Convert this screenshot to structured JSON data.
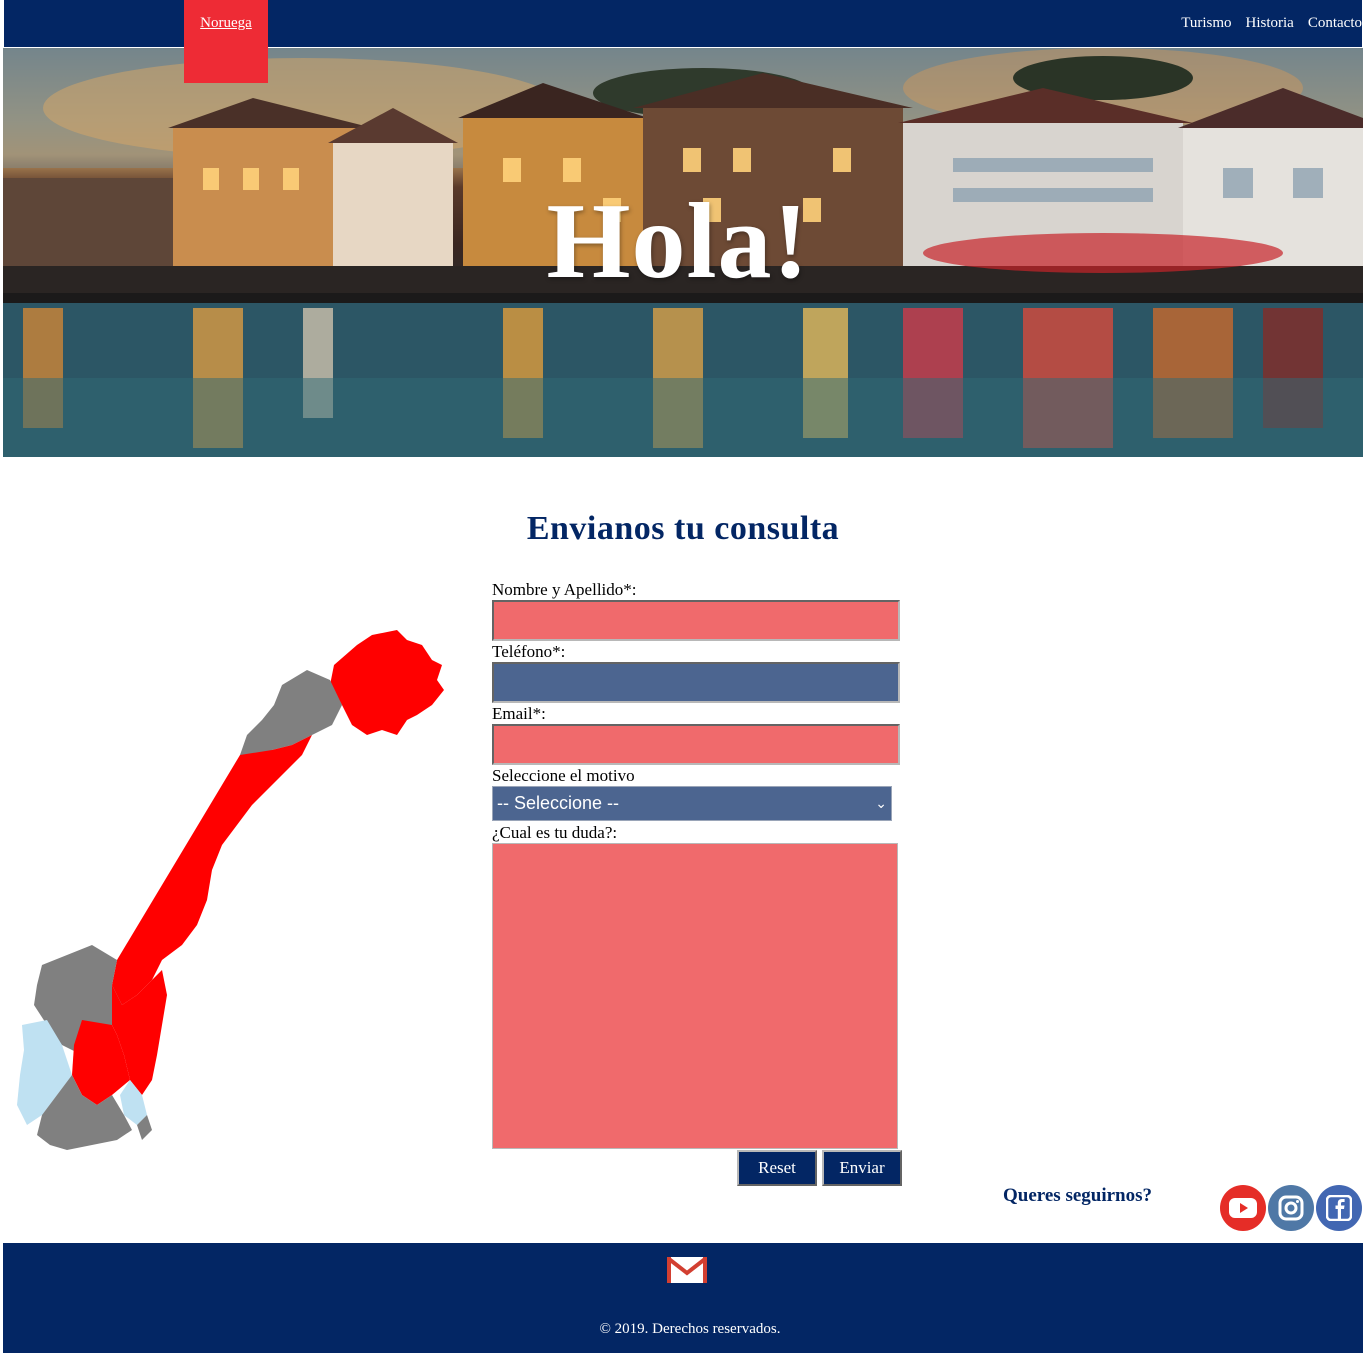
{
  "nav": {
    "brand": "Noruega",
    "links": [
      "Turismo",
      "Historia",
      "Contacto"
    ]
  },
  "hero": {
    "title": "Hola!"
  },
  "contact": {
    "title": "Envianos tu consulta",
    "name_label": "Nombre y Apellido*:",
    "phone_label": "Teléfono*:",
    "email_label": "Email*:",
    "reason_label": "Seleccione el motivo",
    "reason_selected": "-- Seleccione --",
    "question_label": "¿Cual es tu duda?:",
    "reset_label": "Reset",
    "send_label": "Enviar"
  },
  "social": {
    "title": "Queres seguirnos?",
    "icons": [
      "youtube-icon",
      "instagram-icon",
      "facebook-icon"
    ]
  },
  "footer": {
    "copyright": "© 2019. Derechos reservados.",
    "icon": "gmail-icon"
  },
  "colors": {
    "navy": "#032664",
    "brand_red": "#ee2b35",
    "field_red": "#f06a6c",
    "field_blue": "#4c6590",
    "map_red": "#ff0000",
    "map_gray": "#808080",
    "map_light_blue": "#bfe1f2"
  }
}
